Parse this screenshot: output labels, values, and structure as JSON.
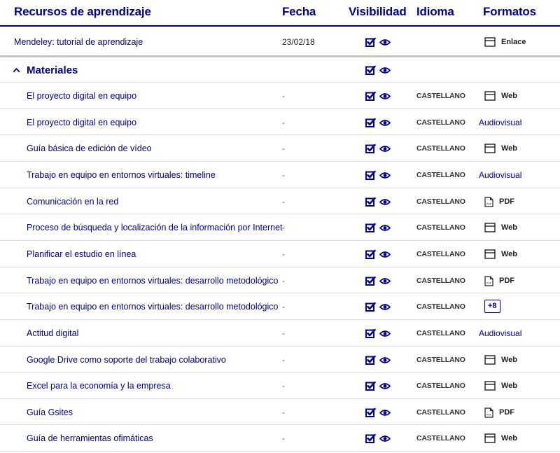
{
  "header": {
    "resources": "Recursos de aprendizaje",
    "date": "Fecha",
    "visibility": "Visibilidad",
    "language": "Idioma",
    "formats": "Formatos"
  },
  "top_item": {
    "title": "Mendeley: tutorial de aprendizaje",
    "date": "23/02/18",
    "format": "Enlace",
    "format_icon": "window-icon"
  },
  "group": {
    "title": "Materiales",
    "toggle_icon": "chevron-up-icon"
  },
  "items": [
    {
      "title": "El proyecto digital en equipo",
      "date": "-",
      "language": "CASTELLANO",
      "format": "Web",
      "format_icon": "window-icon"
    },
    {
      "title": "El proyecto digital en equipo",
      "date": "-",
      "language": "CASTELLANO",
      "format": "Audiovisual",
      "format_icon": ""
    },
    {
      "title": "Guía básica de edición de vídeo",
      "date": "-",
      "language": "CASTELLANO",
      "format": "Web",
      "format_icon": "window-icon"
    },
    {
      "title": "Trabajo en equipo en entornos virtuales: timeline",
      "date": "-",
      "language": "CASTELLANO",
      "format": "Audiovisual",
      "format_icon": ""
    },
    {
      "title": "Comunicación en la red",
      "date": "-",
      "language": "CASTELLANO",
      "format": "PDF",
      "format_icon": "pdf-icon"
    },
    {
      "title": "Proceso de búsqueda y localización de la información por Internet",
      "date": "-",
      "language": "CASTELLANO",
      "format": "Web",
      "format_icon": "window-icon"
    },
    {
      "title": "Planificar el estudio en línea",
      "date": "-",
      "language": "CASTELLANO",
      "format": "Web",
      "format_icon": "window-icon"
    },
    {
      "title": "Trabajo en equipo en entornos virtuales: desarrollo metodológico",
      "date": "-",
      "language": "CASTELLANO",
      "format": "PDF",
      "format_icon": "pdf-icon"
    },
    {
      "title": "Trabajo en equipo en entornos virtuales: desarrollo metodológico",
      "date": "-",
      "language": "CASTELLANO",
      "format": "+8",
      "format_icon": "plus-badge"
    },
    {
      "title": "Actitud digital",
      "date": "-",
      "language": "CASTELLANO",
      "format": "Audiovisual",
      "format_icon": ""
    },
    {
      "title": "Google Drive como soporte del trabajo colaborativo",
      "date": "-",
      "language": "CASTELLANO",
      "format": "Web",
      "format_icon": "window-icon"
    },
    {
      "title": "Excel para la economía y la empresa",
      "date": "-",
      "language": "CASTELLANO",
      "format": "Web",
      "format_icon": "window-icon"
    },
    {
      "title": "Guía Gsites",
      "date": "-",
      "language": "CASTELLANO",
      "format": "PDF",
      "format_icon": "pdf-icon"
    },
    {
      "title": "Guía de herramientas ofimáticas",
      "date": "-",
      "language": "CASTELLANO",
      "format": "Web",
      "format_icon": "window-icon"
    }
  ],
  "colors": {
    "primary": "#000080",
    "divider": "#dedede",
    "group_divider": "#c9c4bf"
  }
}
